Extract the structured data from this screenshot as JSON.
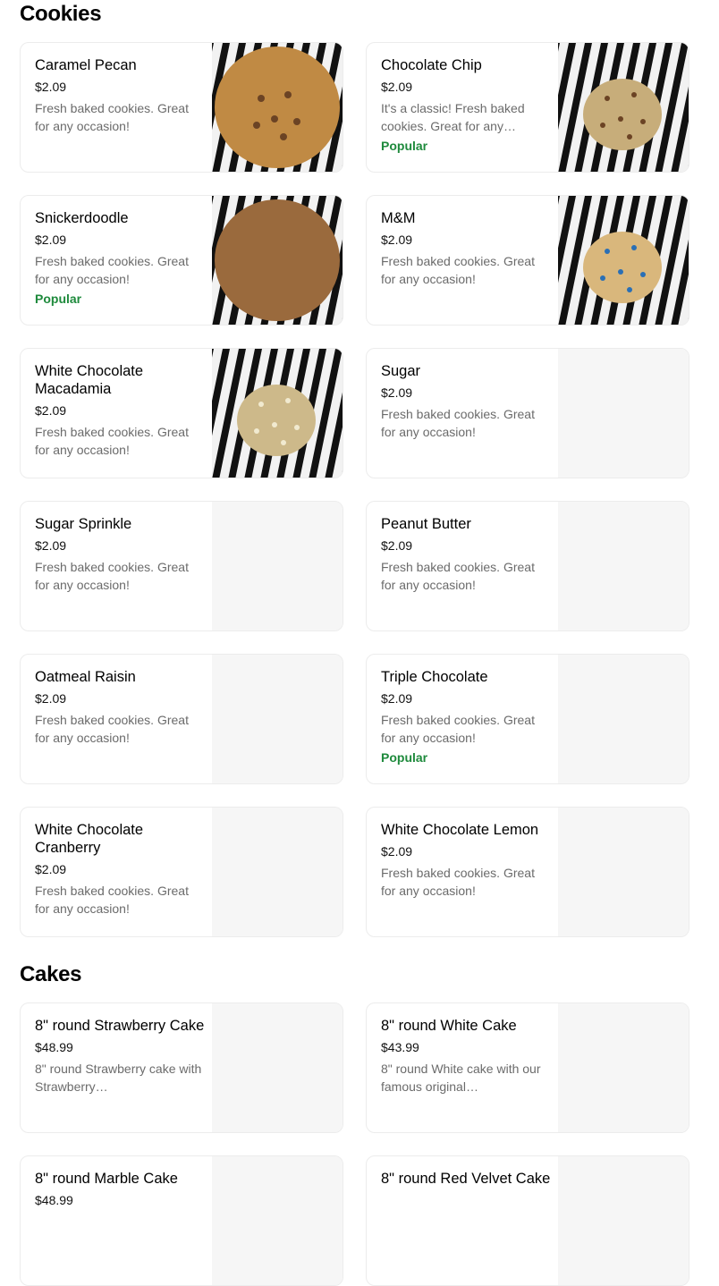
{
  "sections": [
    {
      "title": "Cookies",
      "items": [
        {
          "name": "Caramel Pecan",
          "price": "$2.09",
          "desc": "Fresh baked cookies. Great for any occasion!",
          "badge": "",
          "image": "caramel-pecan"
        },
        {
          "name": "Chocolate Chip",
          "price": "$2.09",
          "desc": "It's a classic! Fresh baked cookies. Great for any…",
          "badge": "Popular",
          "image": "chocolate-chip"
        },
        {
          "name": "Snickerdoodle",
          "price": "$2.09",
          "desc": "Fresh baked cookies. Great for any occasion!",
          "badge": "Popular",
          "image": "snickerdoodle"
        },
        {
          "name": "M&M",
          "price": "$2.09",
          "desc": "Fresh baked cookies. Great for any occasion!",
          "badge": "",
          "image": "mm"
        },
        {
          "name": "White Chocolate Macadamia",
          "price": "$2.09",
          "desc": "Fresh baked cookies. Great for any occasion!",
          "badge": "",
          "image": "white-chocolate-macadamia"
        },
        {
          "name": "Sugar",
          "price": "$2.09",
          "desc": "Fresh baked cookies. Great for any occasion!",
          "badge": "",
          "image": ""
        },
        {
          "name": "Sugar Sprinkle",
          "price": "$2.09",
          "desc": "Fresh baked cookies. Great for any occasion!",
          "badge": "",
          "image": ""
        },
        {
          "name": "Peanut Butter",
          "price": "$2.09",
          "desc": "Fresh baked cookies. Great for any occasion!",
          "badge": "",
          "image": ""
        },
        {
          "name": "Oatmeal Raisin",
          "price": "$2.09",
          "desc": "Fresh baked cookies. Great for any occasion!",
          "badge": "",
          "image": ""
        },
        {
          "name": "Triple Chocolate",
          "price": "$2.09",
          "desc": "Fresh baked cookies. Great for any occasion!",
          "badge": "Popular",
          "image": ""
        },
        {
          "name": "White Chocolate Cranberry",
          "price": "$2.09",
          "desc": "Fresh baked cookies. Great for any occasion!",
          "badge": "",
          "image": ""
        },
        {
          "name": "White Chocolate Lemon",
          "price": "$2.09",
          "desc": "Fresh baked cookies. Great for any occasion!",
          "badge": "",
          "image": ""
        }
      ]
    },
    {
      "title": "Cakes",
      "items": [
        {
          "name": "8\" round Strawberry Cake",
          "price": "$48.99",
          "desc": "8\" round Strawberry cake with Strawberry…",
          "badge": "",
          "image": ""
        },
        {
          "name": "8\" round White Cake",
          "price": "$43.99",
          "desc": "8\" round White cake with our famous original…",
          "badge": "",
          "image": ""
        },
        {
          "name": "8\" round Marble Cake",
          "price": "$48.99",
          "desc": "",
          "badge": "",
          "image": ""
        },
        {
          "name": "8\" round Red Velvet Cake",
          "price": "",
          "desc": "",
          "badge": "",
          "image": ""
        }
      ]
    }
  ],
  "colors": {
    "badge": "#1e8a3c",
    "placeholder": "#f6f6f6",
    "caramel-pecan": "#c08a44",
    "chocolate-chip": "#c7ad7a",
    "snickerdoodle": "#9a6a3d",
    "mm": "#d9b77c",
    "white-chocolate-macadamia": "#cdb98a"
  }
}
